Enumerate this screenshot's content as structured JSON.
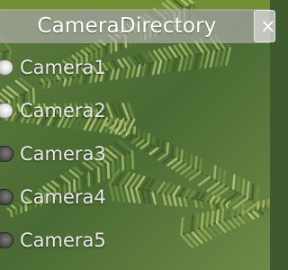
{
  "window": {
    "title": "CameraDirectory",
    "close_label": "×"
  },
  "cameras": [
    {
      "label": "Camera1",
      "selected": true
    },
    {
      "label": "Camera2",
      "selected": true
    },
    {
      "label": "Camera3",
      "selected": false
    },
    {
      "label": "Camera4",
      "selected": false
    },
    {
      "label": "Camera5",
      "selected": false
    }
  ],
  "colors": {
    "panel": "#aaaaa5",
    "text": "#ffffff",
    "foliage_dark": "#3f5a2e",
    "foliage_light": "#a7bd6a"
  }
}
